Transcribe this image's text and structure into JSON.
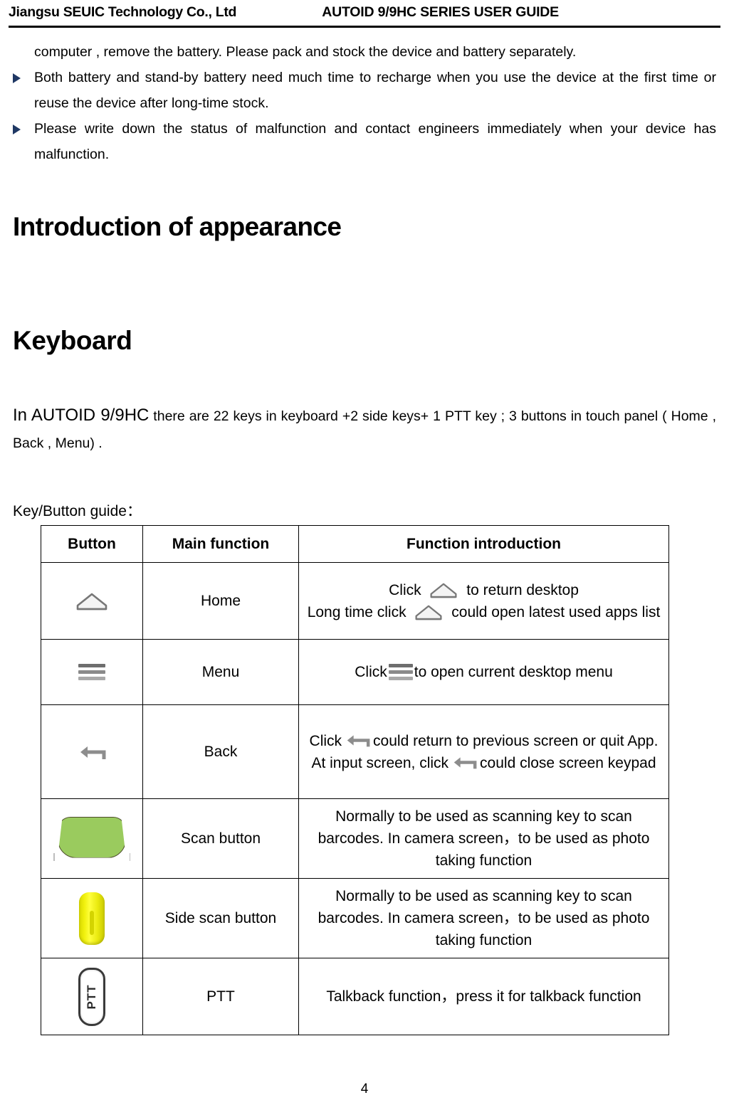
{
  "header": {
    "company": "Jiangsu SEUIC Technology Co., Ltd",
    "guide_title": "AUTOID 9/9HC SERIES USER GUIDE"
  },
  "intro_section": {
    "continued_paragraph": "computer , remove the battery. Please pack and stock the device and battery separately.",
    "bullets": [
      "Both battery and stand-by battery need much time to recharge when you use the device at the first time or reuse the device after long-time stock.",
      "Please write down the status of malfunction and contact engineers immediately when your device has malfunction."
    ],
    "bullet_color": "#1F3864"
  },
  "headings": {
    "appearance": "Introduction of appearance",
    "keyboard": "Keyboard"
  },
  "keyboard_section": {
    "model": "In AUTOID 9/9HC",
    "description": " there are 22 keys in keyboard +2 side keys+ 1 PTT key ; 3 buttons in touch panel ( Home , Back , Menu) .",
    "guide_label": "Key/Button guide："
  },
  "table": {
    "columns": [
      "Button",
      "Main function",
      "Function introduction"
    ],
    "rows": [
      {
        "icon": "home-icon",
        "function": "Home",
        "intro_lines": [
          {
            "pre": "Click",
            "icon": "home-icon",
            "post": "to return desktop"
          },
          {
            "pre": "Long time click",
            "icon": "home-icon",
            "post": "could open latest used apps list"
          }
        ]
      },
      {
        "icon": "menu-icon",
        "function": "Menu",
        "intro_lines": [
          {
            "pre": "Click",
            "icon": "menu-icon",
            "post": "to open current desktop menu"
          }
        ]
      },
      {
        "icon": "back-icon",
        "function": "Back",
        "intro_lines": [
          {
            "pre": "Click",
            "icon": "back-icon",
            "post": "could return to previous screen or quit App."
          },
          {
            "pre": "At input screen, click",
            "icon": "back-icon",
            "post": "could close screen keypad"
          }
        ]
      },
      {
        "icon": "scan-button-icon",
        "function": "Scan button",
        "intro_text": "Normally to be used as scanning key to scan barcodes. In camera screen，to be used as photo taking function"
      },
      {
        "icon": "side-scan-button-icon",
        "function": "Side scan button",
        "intro_text": "Normally to be used as scanning key to scan barcodes. In camera screen，to be used as photo taking function"
      },
      {
        "icon": "ptt-button-icon",
        "function": "PTT",
        "icon_label": "PTT",
        "intro_text": "Talkback function，press it for talkback function"
      }
    ]
  },
  "colors": {
    "scan_green": "#9ACB5E",
    "side_scan_yellow": "#EDED1A",
    "ptt_dark": "#3A3A3A",
    "menu_bar_gray": "#8A8A8A"
  },
  "footer": {
    "page_number": "4"
  }
}
